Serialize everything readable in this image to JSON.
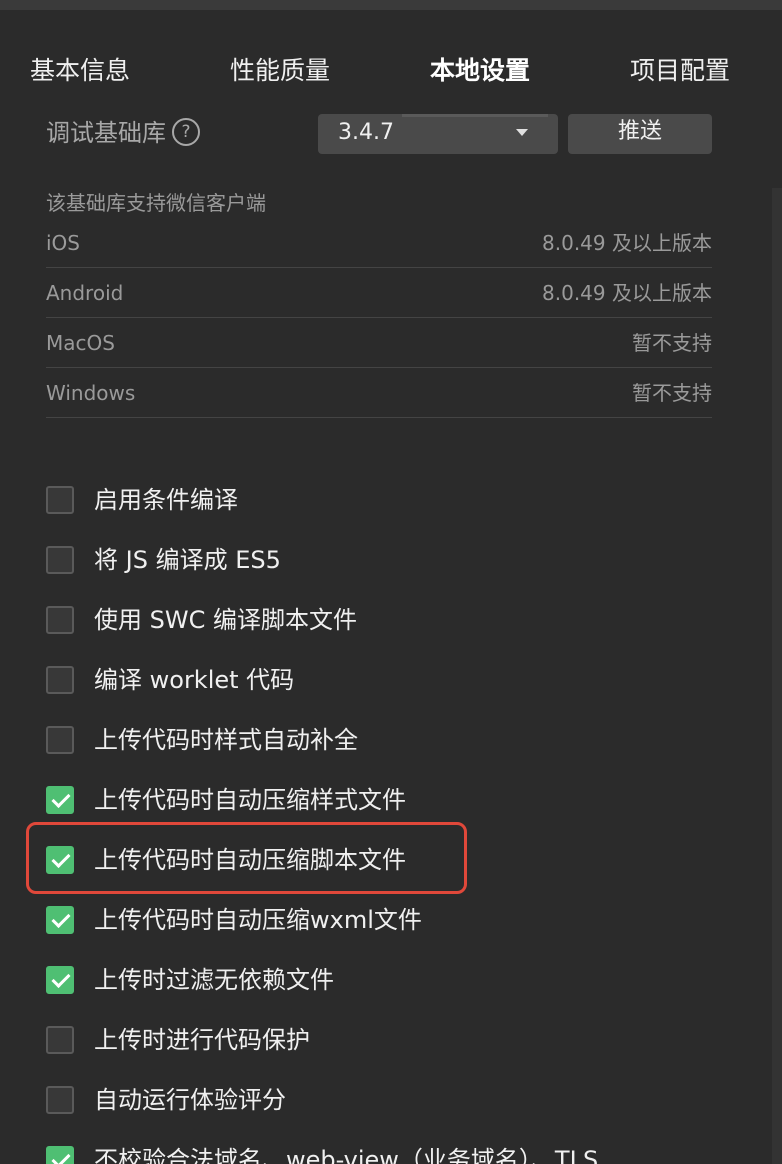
{
  "tabs": [
    {
      "label": "基本信息",
      "active": false
    },
    {
      "label": "性能质量",
      "active": false
    },
    {
      "label": "本地设置",
      "active": true
    },
    {
      "label": "项目配置",
      "active": false
    }
  ],
  "debug_lib": {
    "label": "调试基础库",
    "help_icon": "?",
    "version": "3.4.7",
    "push_label": "推送"
  },
  "support": {
    "caption": "该基础库支持微信客户端",
    "rows": [
      {
        "platform": "iOS",
        "value": "8.0.49 及以上版本"
      },
      {
        "platform": "Android",
        "value": "8.0.49 及以上版本"
      },
      {
        "platform": "MacOS",
        "value": "暂不支持"
      },
      {
        "platform": "Windows",
        "value": "暂不支持"
      }
    ]
  },
  "options": [
    {
      "label": "启用条件编译",
      "checked": false
    },
    {
      "label": "将 JS 编译成 ES5",
      "checked": false
    },
    {
      "label": "使用 SWC 编译脚本文件",
      "checked": false
    },
    {
      "label": "编译 worklet 代码",
      "checked": false
    },
    {
      "label": "上传代码时样式自动补全",
      "checked": false
    },
    {
      "label": "上传代码时自动压缩样式文件",
      "checked": true
    },
    {
      "label": "上传代码时自动压缩脚本文件",
      "checked": true
    },
    {
      "label": "上传代码时自动压缩wxml文件",
      "checked": true
    },
    {
      "label": "上传时过滤无依赖文件",
      "checked": true
    },
    {
      "label": "上传时进行代码保护",
      "checked": false
    },
    {
      "label": "自动运行体验评分",
      "checked": false
    },
    {
      "label": "不校验合法域名、web-view（业务域名）、TLS",
      "checked": true
    }
  ],
  "colors": {
    "background": "#2b2b2b",
    "checked": "#4fbf73",
    "highlight": "#e0483a"
  }
}
